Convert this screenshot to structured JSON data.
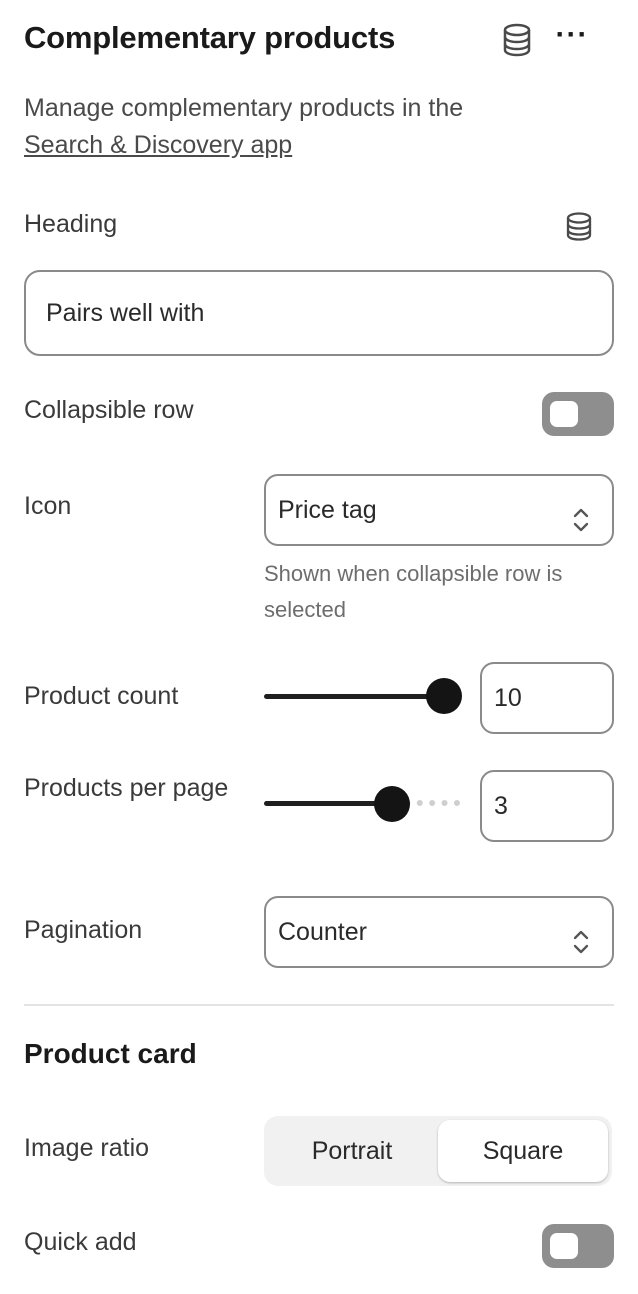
{
  "header": {
    "title": "Complementary products",
    "more_label": "···",
    "db_icon": "database-icon"
  },
  "description": {
    "text": "Manage complementary products in the",
    "link": "Search & Discovery app"
  },
  "heading": {
    "label": "Heading",
    "value": "Pairs well with"
  },
  "collapsible_row": {
    "label": "Collapsible row",
    "enabled": false
  },
  "icon_setting": {
    "label": "Icon",
    "value": "Price tag",
    "hint": "Shown when collapsible row is selected"
  },
  "product_count": {
    "label": "Product count",
    "value": "10",
    "slider_fraction": 1.0
  },
  "products_per_page": {
    "label": "Products per page",
    "value": "3",
    "slider_fraction": 0.65
  },
  "pagination": {
    "label": "Pagination",
    "value": "Counter"
  },
  "product_card": {
    "section_title": "Product card",
    "image_ratio": {
      "label": "Image ratio",
      "options": [
        "Portrait",
        "Square"
      ],
      "selected": "Square"
    },
    "quick_add": {
      "label": "Quick add",
      "enabled": false
    }
  },
  "colors": {
    "toggle_off": "#8e8e8e",
    "slider": "#1f1f1f",
    "border": "#8a8a8a"
  }
}
